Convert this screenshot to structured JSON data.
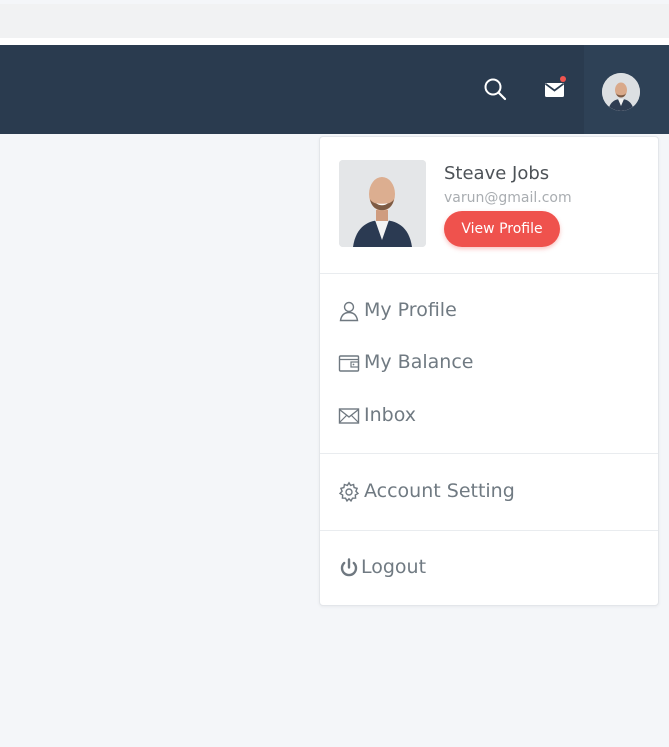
{
  "header": {
    "icons": {
      "search": "search-icon",
      "mail": "mail-icon",
      "notification_dot_color": "#f0544f"
    },
    "navbar_color": "#2a3b4f"
  },
  "user_dropdown": {
    "name": "Steave Jobs",
    "email": "varun@gmail.com",
    "view_profile_label": "View Profile",
    "accent_color": "#ef524d",
    "menu": [
      {
        "label": "My Profile",
        "icon": "user-icon"
      },
      {
        "label": "My Balance",
        "icon": "wallet-icon"
      },
      {
        "label": "Inbox",
        "icon": "mail-icon"
      }
    ],
    "settings": {
      "label": "Account Setting",
      "icon": "gear-icon"
    },
    "logout": {
      "label": "Logout",
      "icon": "power-icon"
    }
  }
}
